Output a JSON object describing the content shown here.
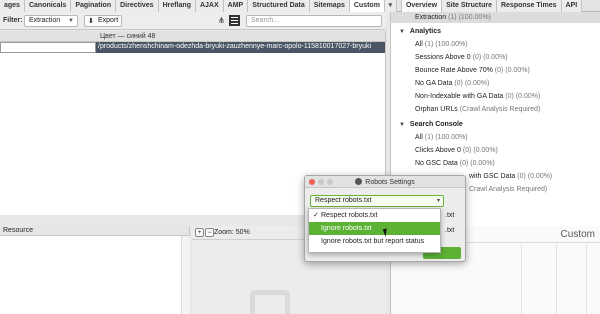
{
  "tabs": [
    "ages",
    "Canonicals",
    "Pagination",
    "Directives",
    "Hreflang",
    "AJAX",
    "AMP",
    "Structured Data",
    "Sitemaps",
    "Custom"
  ],
  "tabs_overflow": "▾",
  "right_tabs": [
    "Overview",
    "Site Structure",
    "Response Times",
    "API"
  ],
  "filter": {
    "label": "Filter:",
    "value": "Extraction",
    "export_label": "Export",
    "search_placeholder": "Search..."
  },
  "table": {
    "column_header": "Цвет — синий 48",
    "row_url": "/products/zhenshchinam-odezhda-bryuki-zauzhennye-marc-opolo-115810017027-bryuki"
  },
  "resource_header": "Resource",
  "zoom_label": "Zoom: 50%",
  "overview": {
    "rows": [
      {
        "label": "Extraction",
        "count": "(1) (100.00%)",
        "type": "item",
        "selected": true
      },
      {
        "label": "Analytics",
        "count": "",
        "type": "header"
      },
      {
        "label": "All",
        "count": "(1) (100.00%)",
        "type": "item"
      },
      {
        "label": "Sessions Above 0",
        "count": "(0) (0.00%)",
        "type": "item"
      },
      {
        "label": "Bounce Rate Above 70%",
        "count": "(0) (0.00%)",
        "type": "item"
      },
      {
        "label": "No GA Data",
        "count": "(0) (0.00%)",
        "type": "item"
      },
      {
        "label": "Non-Indexable with GA Data",
        "count": "(0) (0.00%)",
        "type": "item"
      },
      {
        "label": "Orphan URLs",
        "count": "(Crawl Analysis Required)",
        "type": "item"
      },
      {
        "label": "Search Console",
        "count": "",
        "type": "header"
      },
      {
        "label": "All",
        "count": "(1) (100.00%)",
        "type": "item"
      },
      {
        "label": "Clicks Above 0",
        "count": "(0) (0.00%)",
        "type": "item"
      },
      {
        "label": "No GSC Data",
        "count": "(0) (0.00%)",
        "type": "item"
      },
      {
        "label": "with GSC Data",
        "count": "(0) (0.00%)",
        "type": "item"
      },
      {
        "label": "",
        "count": "Crawl Analysis Required)",
        "type": "item"
      }
    ],
    "custom_title": "Custom"
  },
  "dialog": {
    "title": "Robots Settings",
    "selected": "Respect robots.txt",
    "caret": "▾",
    "bg_text_1": ".txt",
    "bg_text_2": ".txt",
    "options": [
      {
        "label": "Respect robots.txt",
        "check": "✓"
      },
      {
        "label": "Ignore robots.txt",
        "check": ""
      },
      {
        "label": "Ignore robots.txt but report status",
        "check": ""
      }
    ]
  },
  "colors": {
    "accent_green": "#5db135",
    "selected_row": "#4a5663"
  }
}
